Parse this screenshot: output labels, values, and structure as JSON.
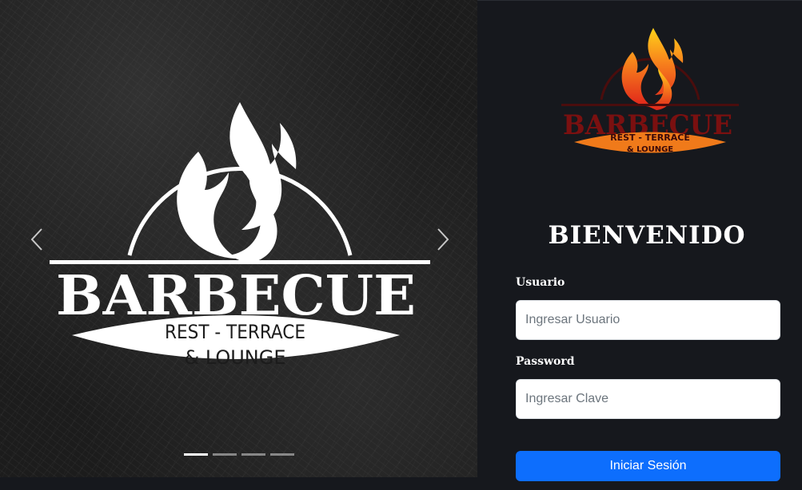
{
  "carousel": {
    "slide_logo": {
      "brand": "BARBECUE",
      "line1": "REST - TERRACE",
      "line2": "& LOUNGE",
      "color": "#ffffff"
    },
    "prev_icon": "chevron-left-icon",
    "next_icon": "chevron-right-icon",
    "indicators_count": 4,
    "active_indicator": 1
  },
  "login": {
    "logo": {
      "brand": "BARBECUE",
      "line1": "REST - TERRACE",
      "line2": "& LOUNGE",
      "brand_color": "#7a1010",
      "band_color": "#f07a1a",
      "flame_colors": [
        "#ffd21a",
        "#f7801c",
        "#e0241b"
      ]
    },
    "title": "BIENVENIDO",
    "username_label": "Usuario",
    "username_placeholder": "Ingresar Usuario",
    "username_value": "",
    "password_label": "Password",
    "password_placeholder": "Ingresar Clave",
    "password_value": "",
    "submit_label": "Iniciar Sesión",
    "accent_color": "#0d6efd"
  }
}
